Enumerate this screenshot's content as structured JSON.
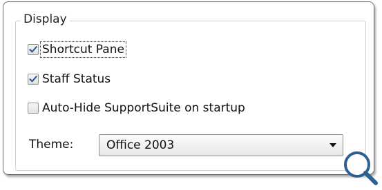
{
  "display": {
    "legend": "Display",
    "options": [
      {
        "label": "Shortcut Pane",
        "checked": true,
        "focused": true
      },
      {
        "label": "Staff Status",
        "checked": true,
        "focused": false
      },
      {
        "label": "Auto-Hide SupportSuite on startup",
        "checked": false,
        "focused": false
      }
    ],
    "theme": {
      "label": "Theme:",
      "value": "Office 2003"
    }
  },
  "icons": {
    "zoom": "magnifier-icon",
    "dropdown": "chevron-down-icon",
    "check": "checkmark-icon"
  },
  "colors": {
    "checkmark": "#2f5d9e",
    "border": "#6a7079"
  }
}
